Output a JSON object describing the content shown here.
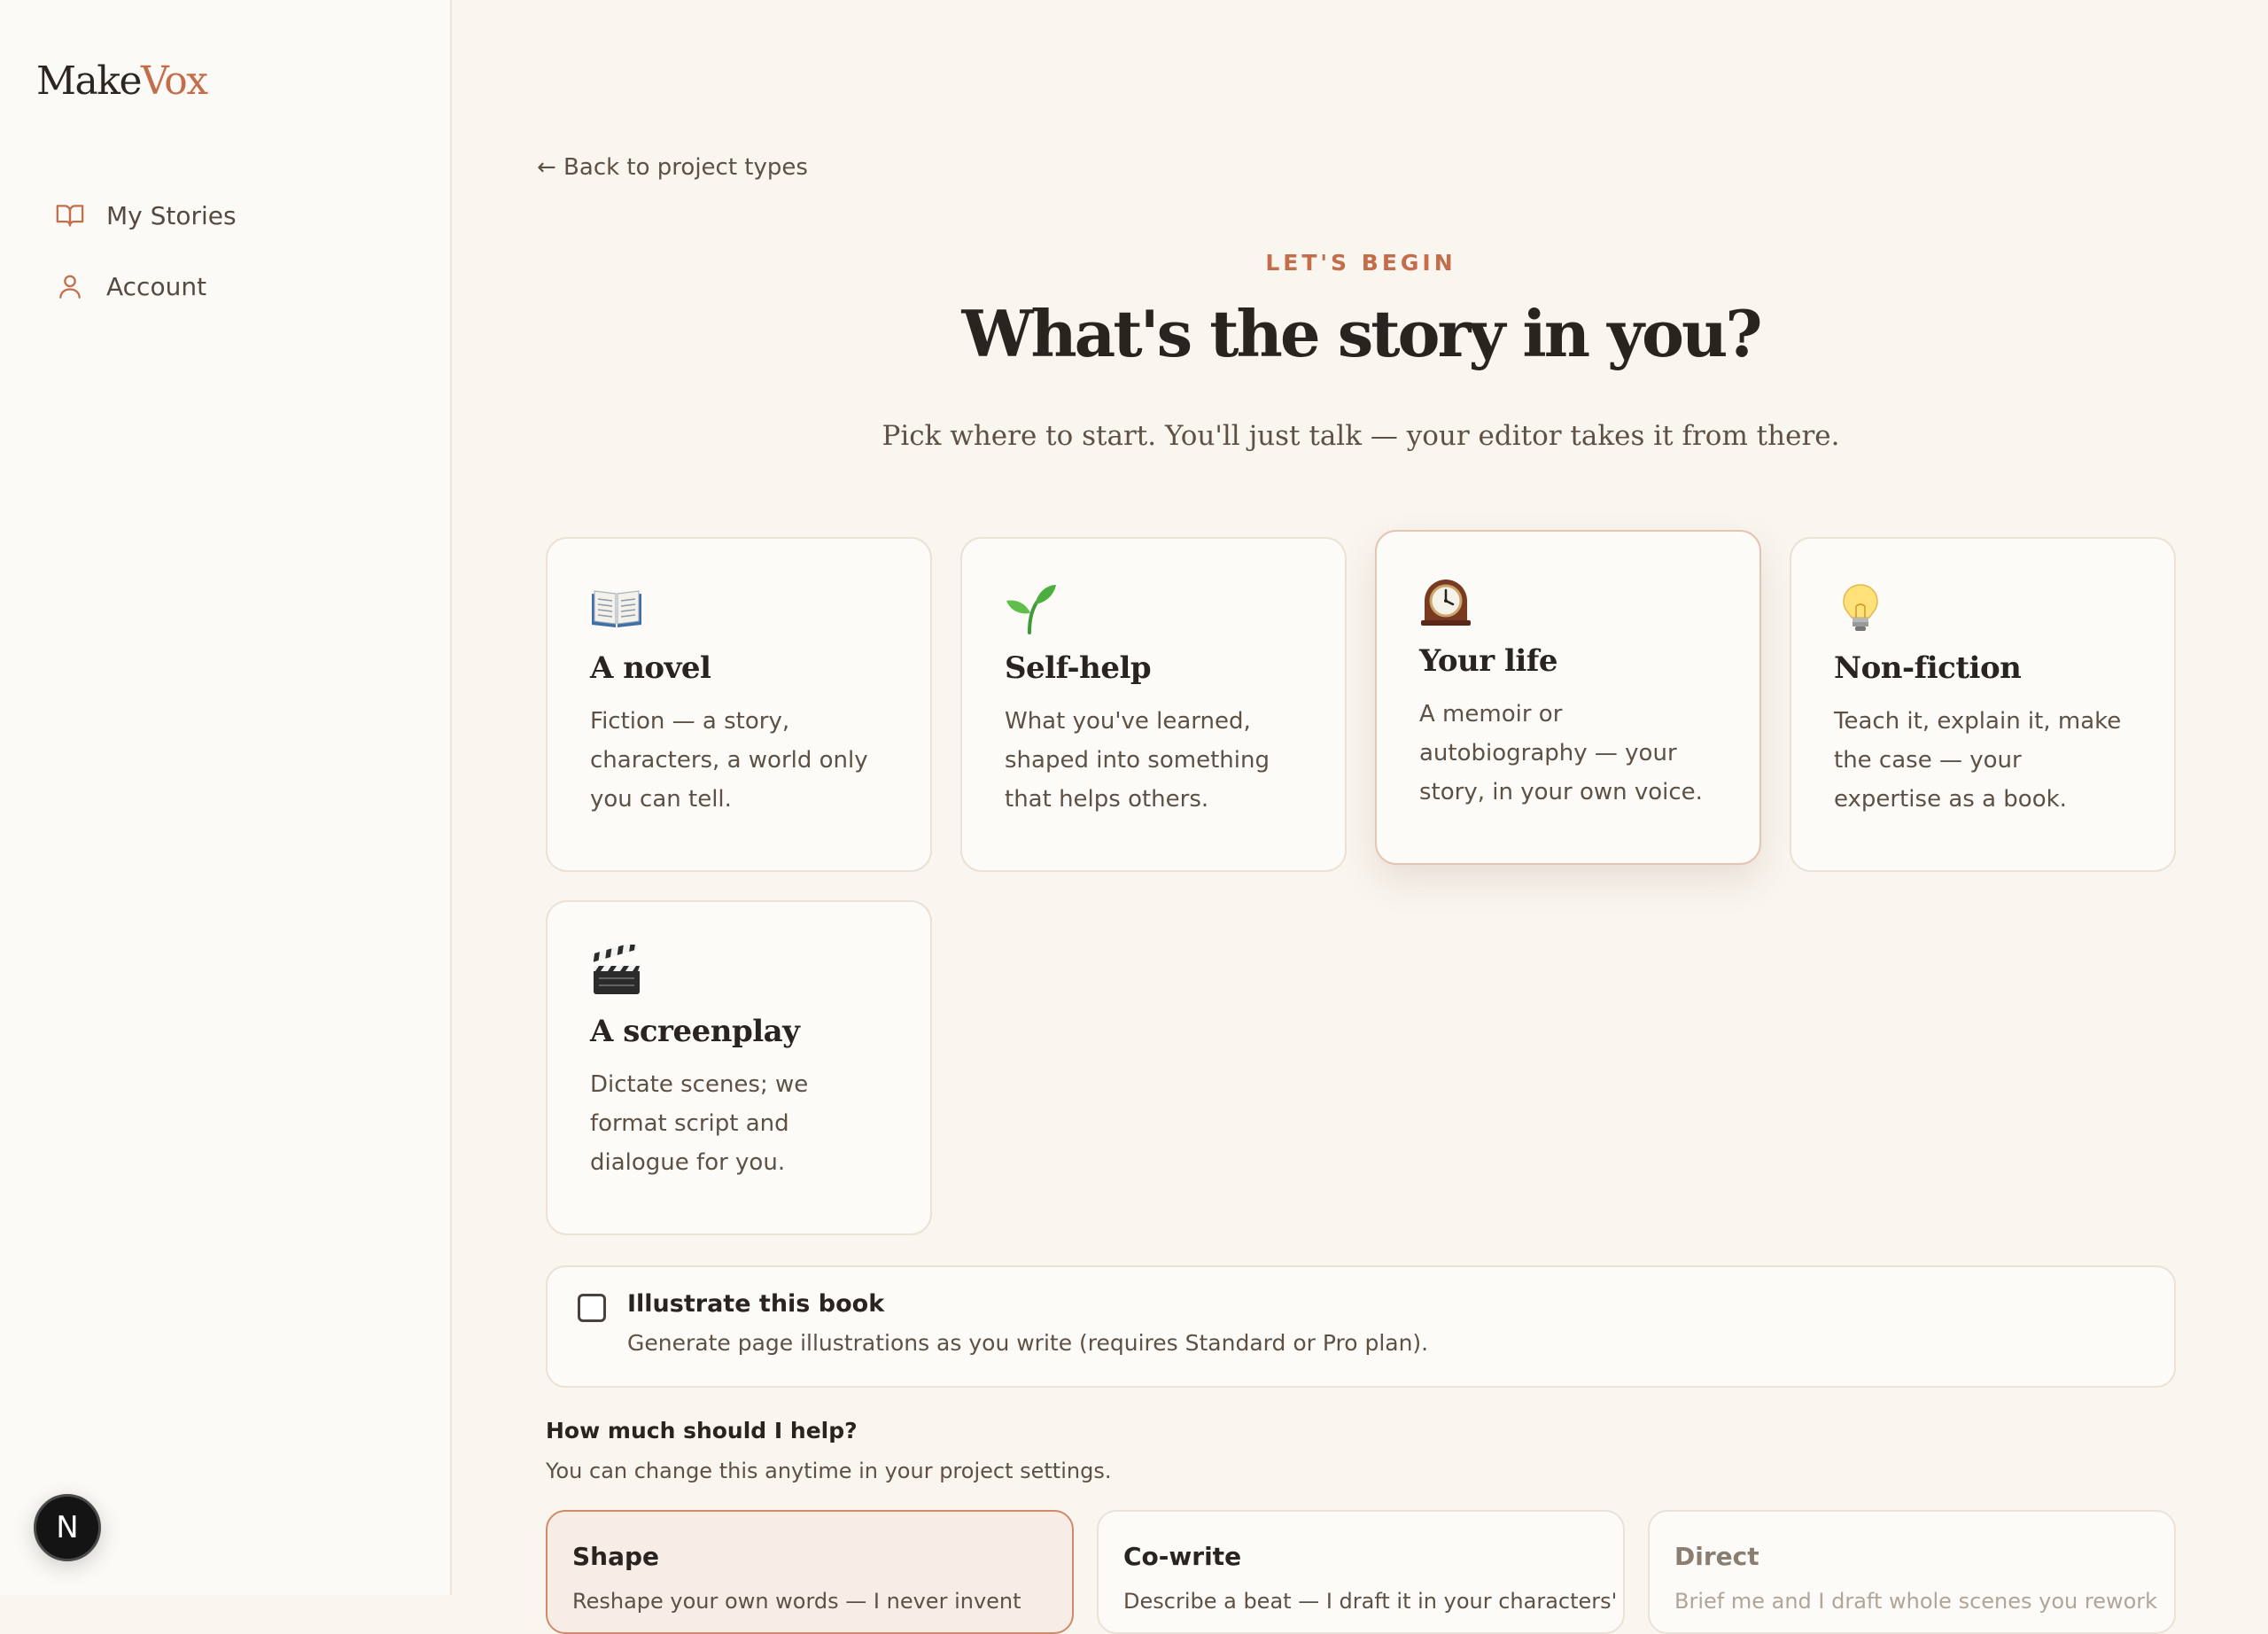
{
  "brand": {
    "part1": "Make",
    "part2": "Vox"
  },
  "sidebar": {
    "items": [
      {
        "label": "My Stories",
        "icon": "book-open-icon"
      },
      {
        "label": "Account",
        "icon": "user-icon"
      }
    ],
    "avatar_letter": "N"
  },
  "header": {
    "back_link": "← Back to project types",
    "eyebrow": "LET'S BEGIN",
    "title": "What's the story in you?",
    "subtitle": "Pick where to start. You'll just talk — your editor takes it from there."
  },
  "project_types": [
    {
      "title": "A novel",
      "description": "Fiction — a story, characters, a world only you can tell.",
      "icon": "open-book-icon"
    },
    {
      "title": "Self-help",
      "description": "What you've learned, shaped into something that helps others.",
      "icon": "seedling-icon"
    },
    {
      "title": "Your life",
      "description": "A memoir or autobiography — your story, in your own voice.",
      "icon": "mantelpiece-clock-icon",
      "selected": true
    },
    {
      "title": "Non-fiction",
      "description": "Teach it, explain it, make the case — your expertise as a book.",
      "icon": "light-bulb-icon"
    },
    {
      "title": "A screenplay",
      "description": "Dictate scenes; we format script and dialogue for you.",
      "icon": "clapper-board-icon"
    }
  ],
  "illustrate": {
    "title": "Illustrate this book",
    "description": "Generate page illustrations as you write (requires Standard or Pro plan).",
    "checked": false
  },
  "help": {
    "title": "How much should I help?",
    "subtitle": "You can change this anytime in your project settings.",
    "modes": [
      {
        "name": "Shape",
        "description": "Reshape your own words — I never invent",
        "active": true
      },
      {
        "name": "Co-write",
        "description": "Describe a beat — I draft it in your characters'"
      },
      {
        "name": "Direct",
        "description": "Brief me and I draft whole scenes you rework"
      }
    ]
  },
  "colors": {
    "accent": "#c46d4a",
    "background": "#f9f5ef",
    "sidebar": "#fcfaf6",
    "text": "#2a2420",
    "muted_text": "#5d5146"
  }
}
